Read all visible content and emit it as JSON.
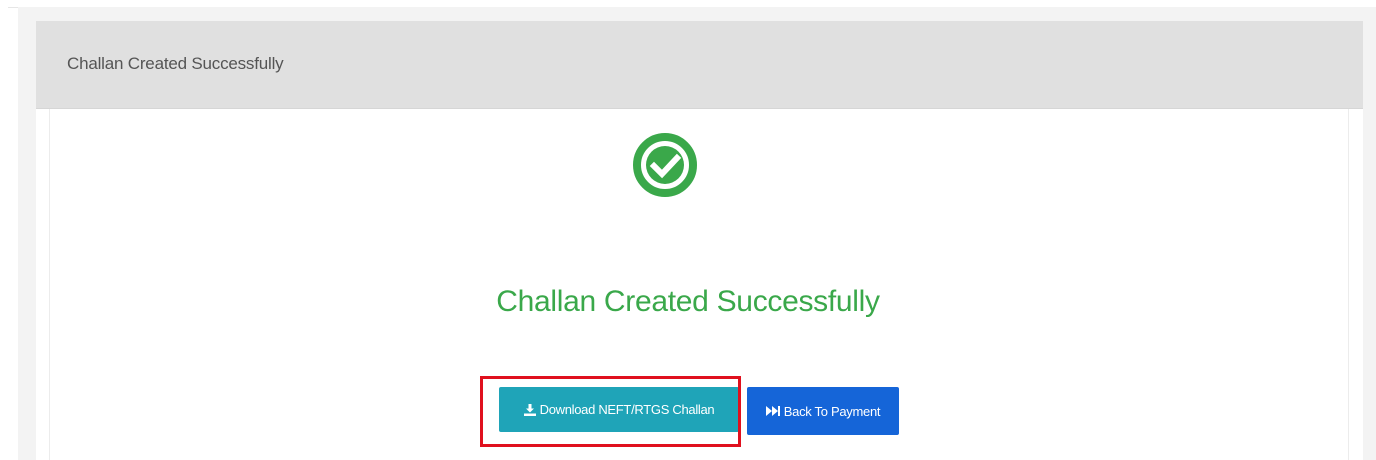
{
  "card": {
    "header_title": "Challan Created Successfully"
  },
  "message": {
    "heading": "Challan Created Successfully",
    "icon": "check-circle-icon",
    "color": "#3aa84a"
  },
  "buttons": {
    "download_label": "Download NEFT/RTGS Challan",
    "download_icon": "download-icon",
    "download_color": "#1fa4b8",
    "back_label": "Back To Payment",
    "back_icon": "fast-forward-icon",
    "back_color": "#1565d8"
  },
  "highlight": {
    "color": "#e0101e"
  }
}
